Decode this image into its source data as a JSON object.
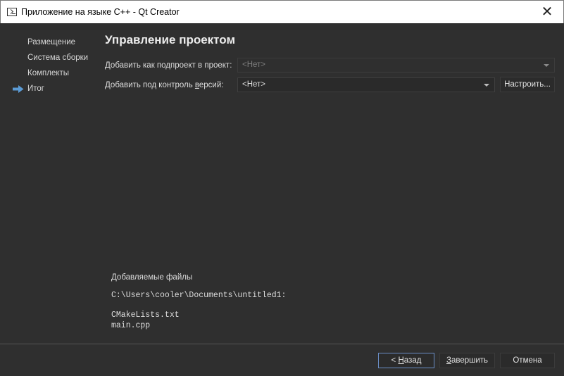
{
  "window": {
    "title": "Приложение на языке С++ - Qt Creator",
    "close_glyph": "✕"
  },
  "sidebar": {
    "items": [
      {
        "label": "Размещение",
        "active": false
      },
      {
        "label": "Система сборки",
        "active": false
      },
      {
        "label": "Комплекты",
        "active": false
      },
      {
        "label": "Итог",
        "active": true
      }
    ],
    "active_icon": "arrow-right-icon",
    "accent_color": "#5b9bd5"
  },
  "main": {
    "heading": "Управление проектом",
    "subproject_label": "Добавить как подпроект в проект:",
    "subproject_value": "<Нет>",
    "vcs_label_pre": "Добавить под контроль ",
    "vcs_label_underlined": "в",
    "vcs_label_post": "ерсий:",
    "vcs_value": "<Нет>",
    "configure_button": "Настроить..."
  },
  "files": {
    "heading": "Добавляемые файлы",
    "path": "C:\\Users\\cooler\\Documents\\untitled1:",
    "list": [
      "CMakeLists.txt",
      "main.cpp"
    ]
  },
  "footer": {
    "back_prefix": "< ",
    "back_underlined": "Н",
    "back_rest": "азад",
    "finish_underlined": "З",
    "finish_rest": "авершить",
    "cancel": "Отмена"
  }
}
